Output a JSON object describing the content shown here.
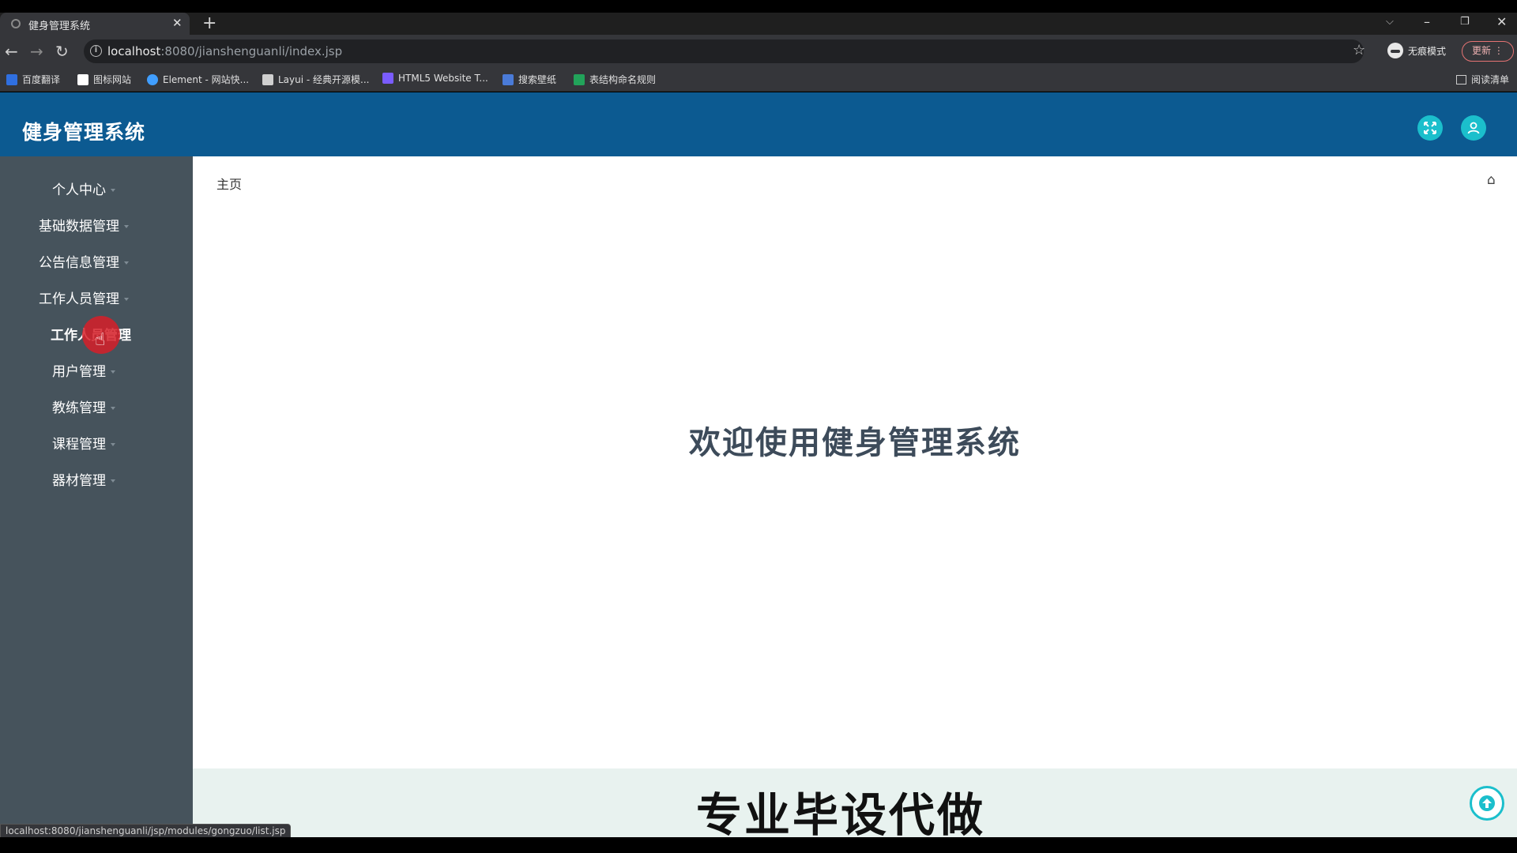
{
  "browser": {
    "tab_title": "健身管理系统",
    "url_host": "localhost",
    "url_rest": ":8080/jianshenguanli/index.jsp",
    "incognito_label": "无痕模式",
    "update_label": "更新",
    "bookmarks": [
      {
        "label": "百度翻译",
        "color": "#2f6fe0"
      },
      {
        "label": "图标网站",
        "color": "#ffffff"
      },
      {
        "label": "Element - 网站快...",
        "color": "#409eff"
      },
      {
        "label": "Layui - 经典开源模...",
        "color": "#cfcfcf"
      },
      {
        "label": "HTML5 Website T...",
        "color": "#7a5cff"
      },
      {
        "label": "搜索壁纸",
        "color": "#4a7bd8"
      },
      {
        "label": "表结构命名规则",
        "color": "#22a35a"
      }
    ],
    "reading_list": "阅读清单",
    "status_url": "localhost:8080/jianshenguanli/jsp/modules/gongzuo/list.jsp"
  },
  "app": {
    "title": "健身管理系统",
    "colors": {
      "header": "#0c5a91",
      "sidebar": "#46535c",
      "accent": "#1bbfcc"
    },
    "sidebar": {
      "items": [
        {
          "label": "个人中心",
          "caret": true
        },
        {
          "label": "基础数据管理",
          "caret": true
        },
        {
          "label": "公告信息管理",
          "caret": true
        },
        {
          "label": "工作人员管理",
          "caret": true
        },
        {
          "label": "工作人员管理",
          "caret": false,
          "sub": true
        },
        {
          "label": "用户管理",
          "caret": true
        },
        {
          "label": "教练管理",
          "caret": true
        },
        {
          "label": "课程管理",
          "caret": true
        },
        {
          "label": "器材管理",
          "caret": true
        }
      ]
    },
    "breadcrumb": "主页",
    "welcome": "欢迎使用健身管理系统",
    "footer_banner": "专业毕设代做"
  }
}
